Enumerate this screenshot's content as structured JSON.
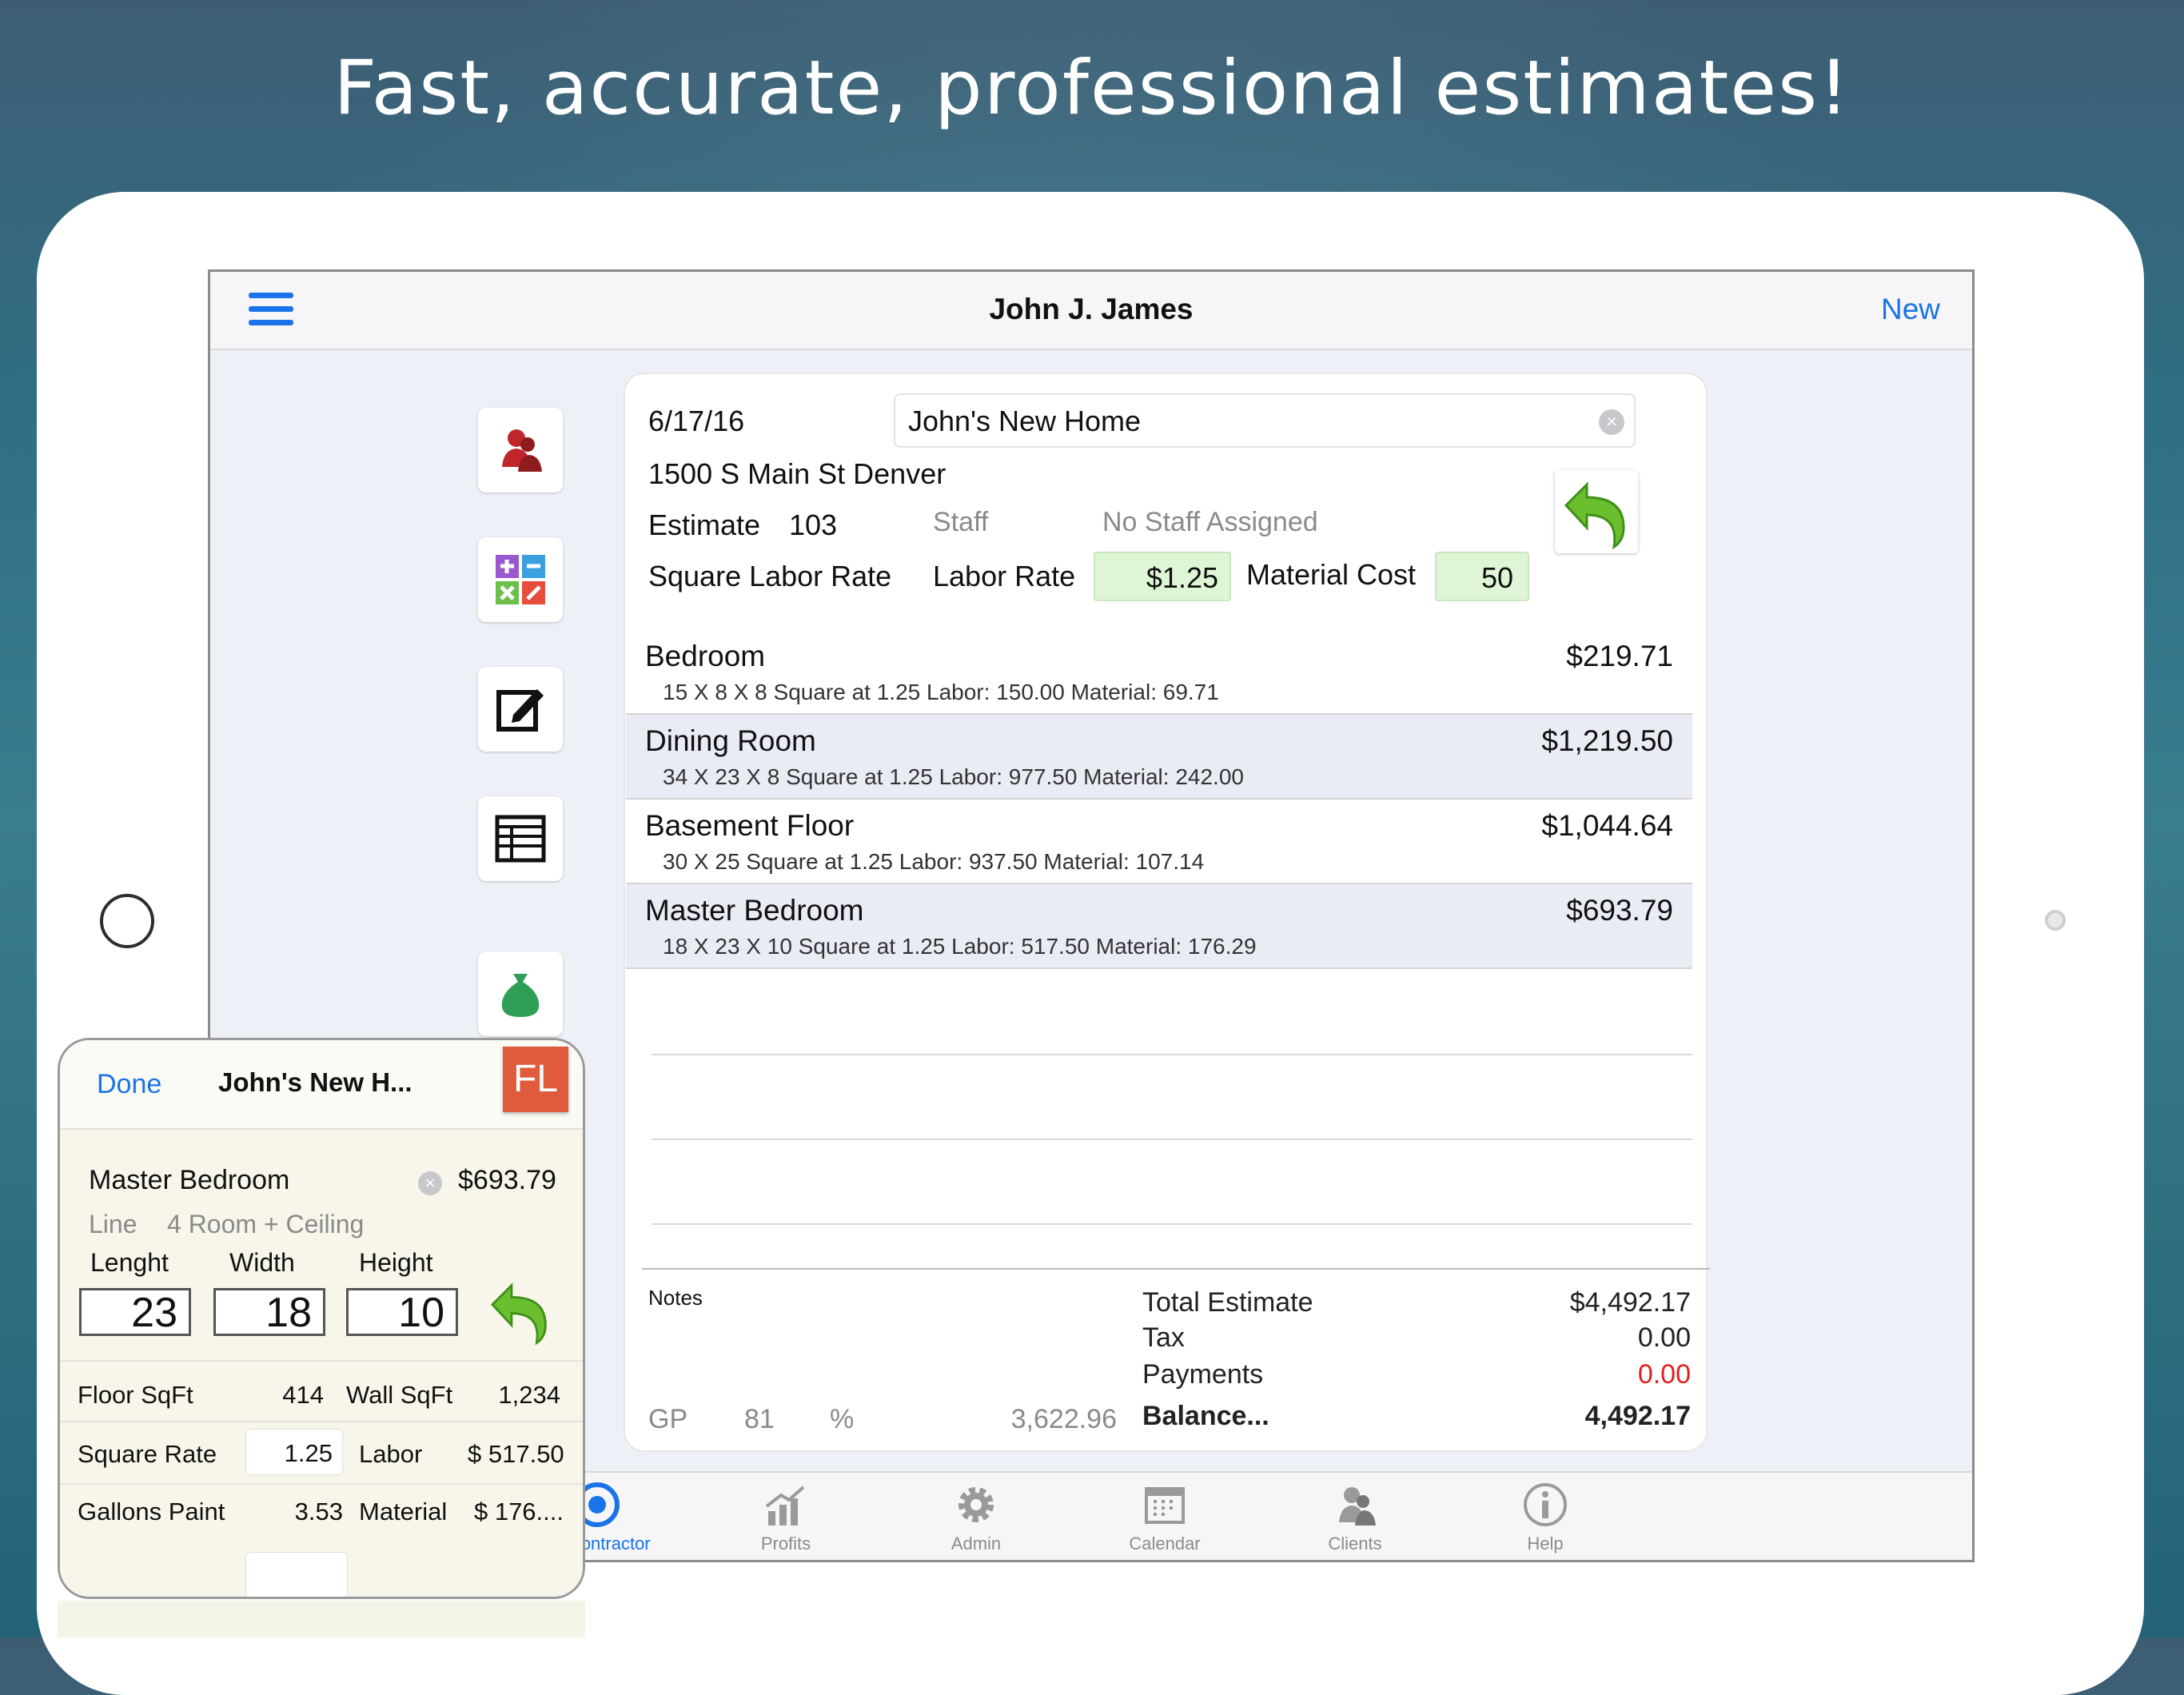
{
  "headline": "Fast, accurate, professional estimates!",
  "navbar": {
    "title": "John J. James",
    "new_label": "New"
  },
  "side_buttons": [
    "clients-icon",
    "calculator-icon",
    "edit-icon",
    "table-icon",
    "money-bag-icon"
  ],
  "estimate": {
    "date": "6/17/16",
    "job_name": "John's New Home",
    "address": "1500 S Main St  Denver",
    "estimate_label": "Estimate",
    "estimate_number": "103",
    "staff_label": "Staff",
    "staff_value": "No Staff Assigned",
    "rate_type": "Square Labor Rate",
    "labor_rate_label": "Labor Rate",
    "labor_rate_value": "$1.25",
    "material_cost_label": "Material Cost",
    "material_cost_value": "50"
  },
  "rooms": [
    {
      "name": "Bedroom",
      "amount": "$219.71",
      "detail": "15 X 8 X 8 Square at 1.25  Labor: 150.00  Material: 69.71"
    },
    {
      "name": "Dining Room",
      "amount": "$1,219.50",
      "detail": "34 X 23 X 8 Square at 1.25  Labor: 977.50  Material: 242.00"
    },
    {
      "name": "Basement Floor",
      "amount": "$1,044.64",
      "detail": "30 X 25 Square at 1.25  Labor: 937.50 Material: 107.14"
    },
    {
      "name": "Master Bedroom",
      "amount": "$693.79",
      "detail": "18 X 23 X 10 Square at 1.25  Labor: 517.50  Material: 176.29"
    }
  ],
  "summary": {
    "notes_label": "Notes",
    "gp_label": "GP",
    "gp_value": "81",
    "gp_percent": "%",
    "gp_amount": "3,622.96",
    "total_label": "Total Estimate",
    "total_value": "$4,492.17",
    "tax_label": "Tax",
    "tax_value": "0.00",
    "payments_label": "Payments",
    "payments_value": "0.00",
    "balance_label": "Balance...",
    "balance_value": "4,492.17",
    "payments_color": "#e02020"
  },
  "tabs": [
    {
      "label": "ng Contractor",
      "icon": "target-icon",
      "active": true
    },
    {
      "label": "Profits",
      "icon": "profits-chart-icon"
    },
    {
      "label": "Admin",
      "icon": "gear-icon"
    },
    {
      "label": "Calendar",
      "icon": "calendar-icon"
    },
    {
      "label": "Clients",
      "icon": "clients-icon"
    },
    {
      "label": "Help",
      "icon": "info-icon"
    }
  ],
  "popover": {
    "done_label": "Done",
    "title": "John's New H...",
    "badge": "FL",
    "room_name": "Master Bedroom",
    "room_amount": "$693.79",
    "line_label": "Line",
    "line_value": "4 Room + Ceiling",
    "length_label": "Lenght",
    "width_label": "Width",
    "height_label": "Height",
    "length_value": "23",
    "width_value": "18",
    "height_value": "10",
    "floor_sqft_label": "Floor SqFt",
    "floor_sqft_value": "414",
    "wall_sqft_label": "Wall SqFt",
    "wall_sqft_value": "1,234",
    "square_rate_label": "Square Rate",
    "square_rate_value": "1.25",
    "labor_label": "Labor",
    "labor_value": "$ 517.50",
    "gallons_label": "Gallons Paint",
    "gallons_value": "3.53",
    "material_label": "Material",
    "material_value": "$ 176...."
  },
  "colors": {
    "accent": "#1a73e8",
    "green_field": "#dff6d6",
    "badge": "#e05a3c"
  }
}
